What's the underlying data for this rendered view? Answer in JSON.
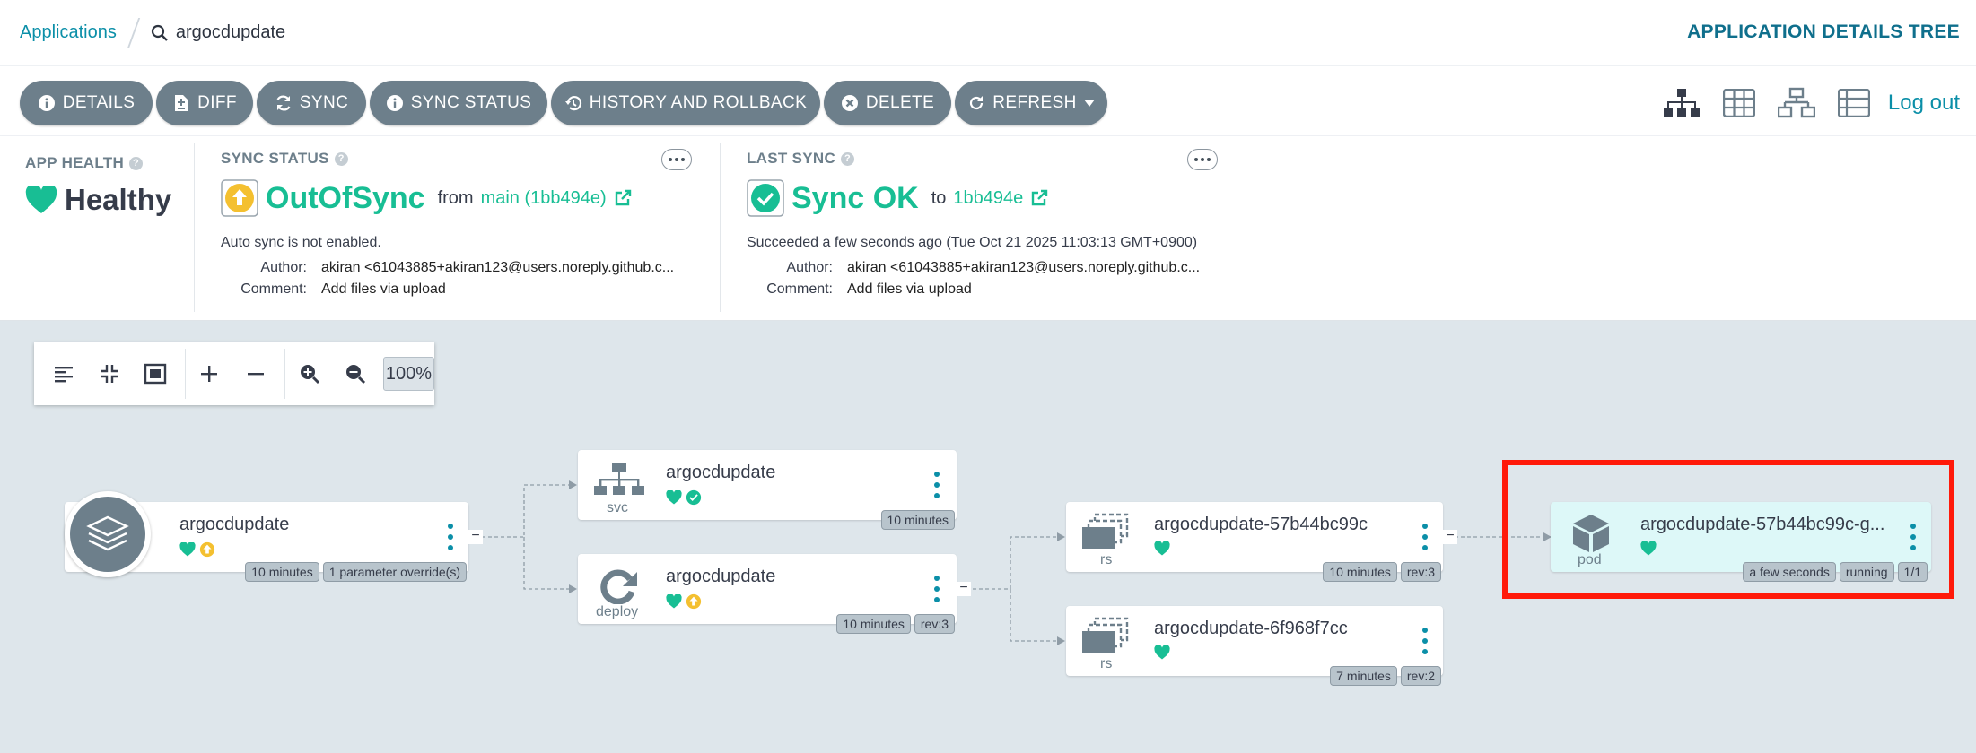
{
  "breadcrumb": {
    "root": "Applications",
    "current": "argocdupdate"
  },
  "page_title": "APPLICATION DETAILS TREE",
  "toolbar": {
    "details": "DETAILS",
    "diff": "DIFF",
    "sync": "SYNC",
    "sync_status": "SYNC STATUS",
    "history": "HISTORY AND ROLLBACK",
    "delete": "DELETE",
    "refresh": "REFRESH",
    "logout": "Log out"
  },
  "app_health": {
    "title": "APP HEALTH",
    "status": "Healthy"
  },
  "sync_status": {
    "title": "SYNC STATUS",
    "status": "OutOfSync",
    "from_label": "from",
    "revision": "main (1bb494e)",
    "auto_sync": "Auto sync is not enabled.",
    "author_label": "Author:",
    "author": "akiran <61043885+akiran123@users.noreply.github.c...",
    "comment_label": "Comment:",
    "comment": "Add files via upload"
  },
  "last_sync": {
    "title": "LAST SYNC",
    "status": "Sync OK",
    "to_label": "to",
    "revision": "1bb494e",
    "succeeded": "Succeeded a few seconds ago (Tue Oct 21 2025 11:03:13 GMT+0900)",
    "author_label": "Author:",
    "author": "akiran <61043885+akiran123@users.noreply.github.c...",
    "comment_label": "Comment:",
    "comment": "Add files via upload"
  },
  "canvas": {
    "zoom": "100%"
  },
  "nodes": {
    "app": {
      "name": "argocdupdate",
      "tags": [
        "10 minutes",
        "1 parameter override(s)"
      ]
    },
    "svc": {
      "name": "argocdupdate",
      "kind": "svc",
      "tags": [
        "10 minutes"
      ]
    },
    "deploy": {
      "name": "argocdupdate",
      "kind": "deploy",
      "tags": [
        "10 minutes",
        "rev:3"
      ]
    },
    "rs1": {
      "name": "argocdupdate-57b44bc99c",
      "kind": "rs",
      "tags": [
        "10 minutes",
        "rev:3"
      ]
    },
    "rs2": {
      "name": "argocdupdate-6f968f7cc",
      "kind": "rs",
      "tags": [
        "7 minutes",
        "rev:2"
      ]
    },
    "pod": {
      "name": "argocdupdate-57b44bc99c-g...",
      "kind": "pod",
      "tags": [
        "a few seconds",
        "running",
        "1/1"
      ]
    }
  },
  "colors": {
    "accent": "#0b8fa8",
    "healthy": "#18be94",
    "outofsync": "#f4c030",
    "highlight": "#ff1a0a"
  }
}
